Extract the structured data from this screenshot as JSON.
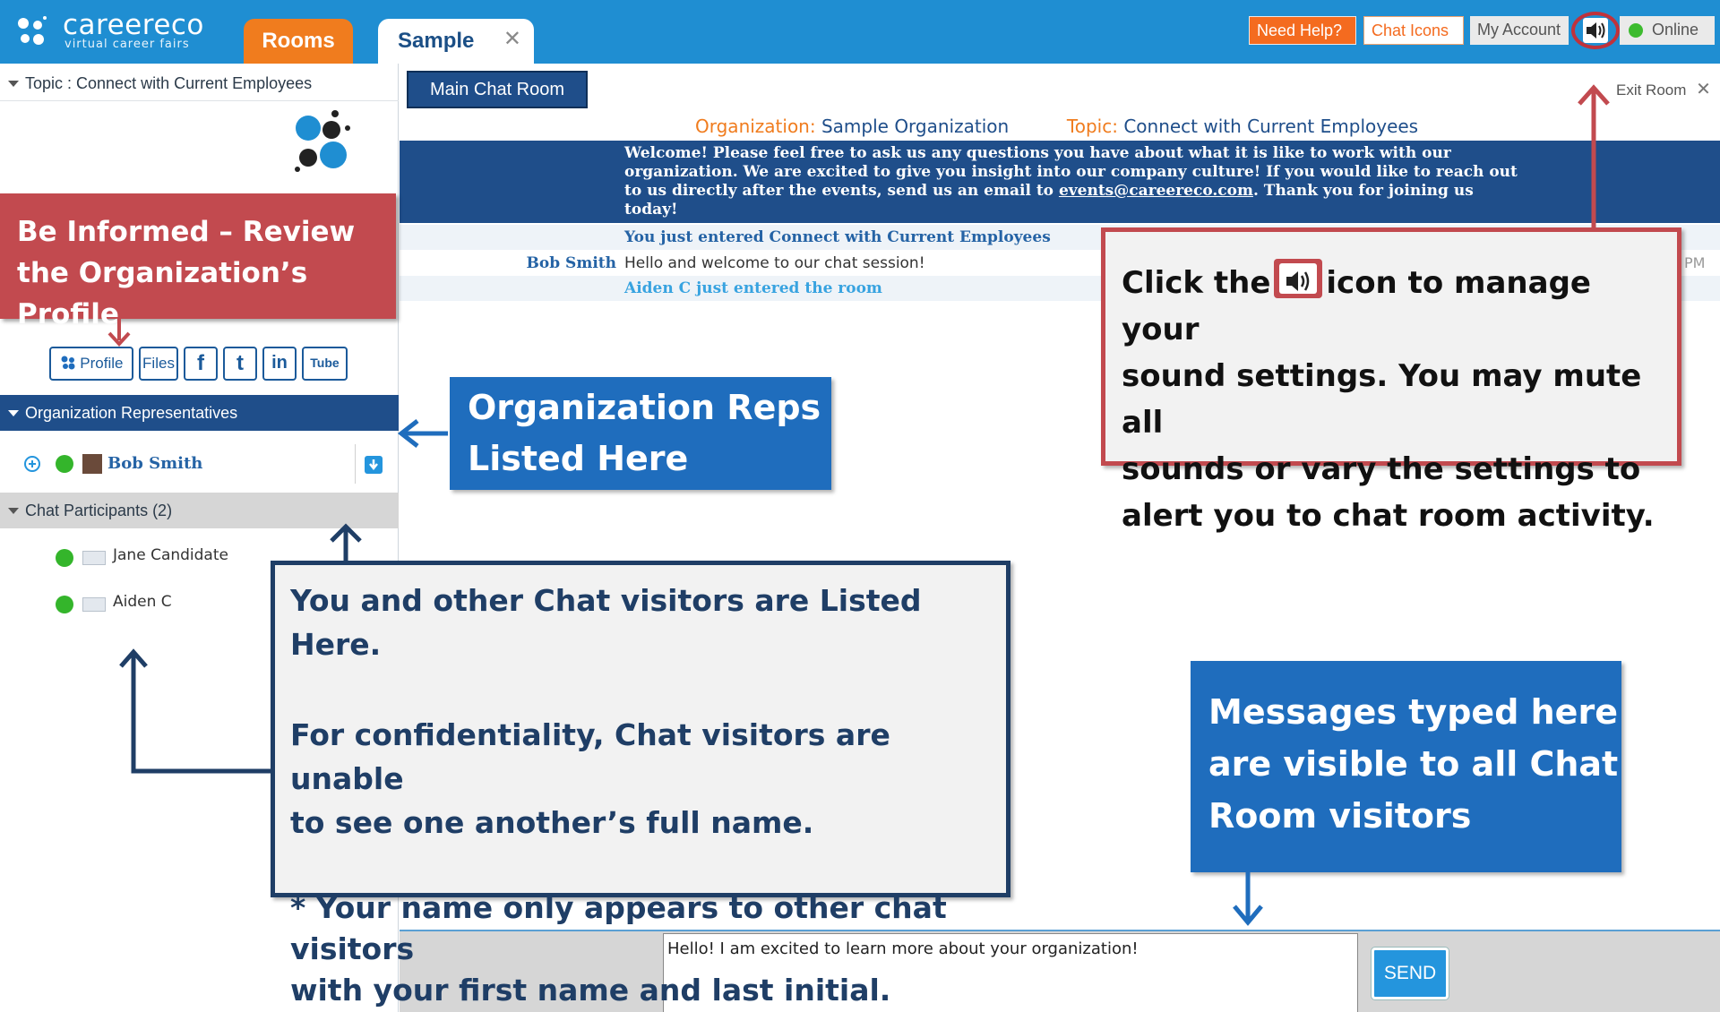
{
  "header": {
    "logo_name": "careereco",
    "logo_tagline": "virtual career fairs",
    "tabs": [
      {
        "label": "Rooms"
      },
      {
        "label": "Sample"
      }
    ],
    "tab_close": "✕",
    "need_help": "Need Help?",
    "chat_icons": "Chat Icons",
    "my_account": "My Account",
    "online": "Online",
    "online_color": "#3dbb2f"
  },
  "left": {
    "topic": "Topic : Connect with Current Employees",
    "social": [
      "Profile",
      "Files",
      "f",
      "t",
      "in",
      "Tube"
    ],
    "reps_header": "Organization Representatives",
    "reps": [
      {
        "name": "Bob Smith"
      }
    ],
    "participants_header": "Chat Participants (2)",
    "participants": [
      {
        "name": "Jane Candidate"
      },
      {
        "name": "Aiden C"
      }
    ]
  },
  "main": {
    "room_tab": "Main Chat Room",
    "exit_room": "Exit Room",
    "org_label": "Organization:",
    "org_name": "Sample Organization",
    "topic_label": "Topic:",
    "topic_name": "Connect with Current Employees",
    "welcome_before": "Welcome! Please feel free to ask us any questions you have about what it is like to work with our organization. We are excited to give you insight into our company culture! If you would like to reach out to us directly after the events, send us an email to ",
    "welcome_email": "events@careereco.com",
    "welcome_after": ". Thank you for joining us today!",
    "messages": [
      {
        "sender": "",
        "text": "You just entered Connect with Current Employees"
      },
      {
        "sender": "Bob Smith",
        "text": "Hello and welcome to our chat session!",
        "time": "PM"
      },
      {
        "sender": "",
        "text": "Aiden C just entered the room"
      }
    ],
    "input_value": "Hello! I am excited to learn more about your organization!",
    "send": "SEND"
  },
  "callouts": {
    "profile_line1": "Be Informed –  Review",
    "profile_line2": "the Organization’s Profile",
    "reps_line1": "Organization Reps",
    "reps_line2": "Listed Here",
    "sound_before": "Click the",
    "sound_after": "icon to manage your",
    "sound_line2": "sound settings.  You may mute all",
    "sound_line3": "sounds or vary the settings to",
    "sound_line4": "alert you to chat room activity.",
    "visitors_line1": "You and other Chat visitors are Listed Here.",
    "visitors_line2": "For confidentiality, Chat visitors are unable",
    "visitors_line3": "to see one another’s full name.",
    "visitors_line4": "* Your name only appears to other chat visitors",
    "visitors_line5": "with your first name and last initial.",
    "messages_line1": "Messages typed here",
    "messages_line2": "are visible to all Chat",
    "messages_line3": "Room visitors"
  }
}
